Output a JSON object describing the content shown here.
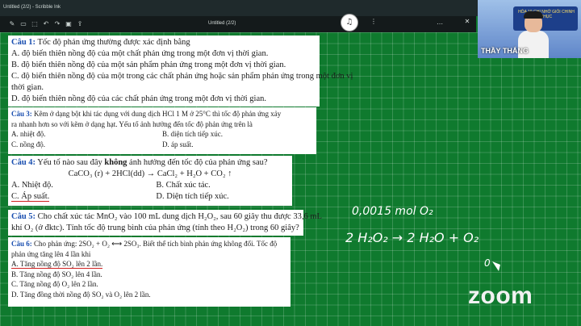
{
  "window": {
    "app_title": "Untitled (2/2) - Scribble Ink",
    "doc_title": "Untitled (2/2)"
  },
  "toolbar": {
    "icons": [
      "pen-icon",
      "eraser-icon",
      "select-icon",
      "undo-icon",
      "redo-icon",
      "save-icon",
      "export-icon",
      "more-icon"
    ]
  },
  "presenter": {
    "name": "THẦY THẮNG",
    "banner": "HÓA 10 GHI NHỚ GIỎI CHINH PHỤC"
  },
  "questions": {
    "q1": {
      "label": "Câu 1:",
      "stem": " Tốc độ phản ứng thường được xác định bằng",
      "a": "A. độ biến thiên nồng độ của một chất phản ứng trong một đơn vị thời gian.",
      "b": "B. độ biến thiên nồng độ của một sản phẩm phản ứng trong một đơn vị thời gian.",
      "c1": "C. độ biến thiên nồng độ của một trong các chất phản ứng hoặc sản phẩm phản ứng trong một đơn vị",
      "c2": "thời gian.",
      "d": "D. độ biến thiên nồng độ của các chất phản ứng trong một đơn vị thời gian."
    },
    "q3": {
      "label": "Câu 3:",
      "stem1": " Kẽm ở dạng bột khi tác dụng với dung dịch HCl 1 M ở 25°C thì tốc độ phản ứng xảy",
      "stem2": "ra nhanh hơn so với kẽm ở dạng hạt. Yếu tố ảnh hưởng đến tốc độ phản ứng trên là",
      "a": "A. nhiệt độ.",
      "b": "B. diện tích tiếp xúc.",
      "c": "C. nồng độ.",
      "d": "D. áp suất."
    },
    "q4": {
      "label": "Câu 4:",
      "stem_pre": " Yếu tố nào sau đây ",
      "stem_bold": "không",
      "stem_post": " ảnh hưởng đến tốc độ của phản ứng sau?",
      "equation": "CaCO₃ (r) + 2HCl(dd) → CaCl₂ + H₂O + CO₂ ↑",
      "a": "A. Nhiệt độ.",
      "b": "B. Chất xúc tác.",
      "c": "C. Áp suất.",
      "d": "D. Diện tích tiếp xúc."
    },
    "q5": {
      "label": "Câu 5:",
      "stem1": " Cho chất xúc tác MnO₂ vào 100 mL dung dịch H₂O₂, sau 60 giây thu được 33,6 mL",
      "stem2": "khí O₂ (ở đktc). Tính tốc độ trung bình của phản ứng (tính theo H₂O₂) trong 60 giây?"
    },
    "q6": {
      "label": "Câu 6:",
      "stem1": " Cho phản ứng: 2SO₂ + O₂ ⟷ 2SO₃. Biết thể tích bình phản ứng không đổi. Tốc độ",
      "stem2": "phản ứng tăng lên 4 lần khi",
      "a": "A. Tăng nồng độ SO₂ lên 2 lần.",
      "b": "B. Tăng nồng độ SO₂ lên 4 lần.",
      "c": "C. Tăng nồng độ O₂ lên 2 lần.",
      "d": "D. Tăng đồng thời nồng độ SO₂ và O₂ lên 2 lần."
    }
  },
  "handwriting": {
    "line1": "0,0015 mol O₂",
    "line2": "2 H₂O₂ → 2 H₂O + O₂",
    "line3": "0"
  },
  "zoom": {
    "logo": "zoom"
  },
  "colors": {
    "board": "#0f7a2e",
    "accent": "#1a4fb0",
    "underline": "#d12020"
  }
}
